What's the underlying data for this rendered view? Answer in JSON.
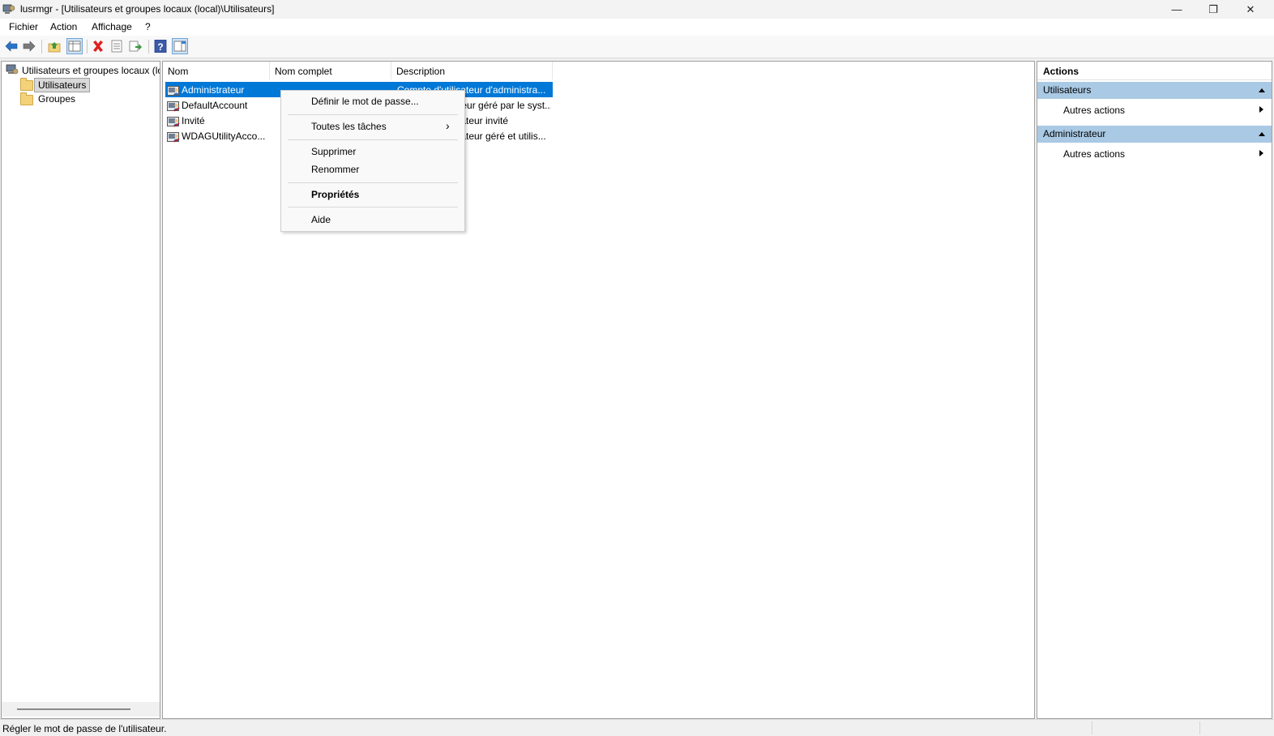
{
  "window": {
    "title": "lusrmgr - [Utilisateurs et groupes locaux (local)\\Utilisateurs]",
    "minimize_glyph": "—",
    "restore_glyph": "❐",
    "close_glyph": "✕"
  },
  "menu": {
    "items": [
      "Fichier",
      "Action",
      "Affichage",
      "?"
    ]
  },
  "toolbar": {
    "buttons": [
      "back-icon",
      "forward-icon",
      "up-folder-icon",
      "show-hide-tree-icon",
      "delete-icon",
      "properties-icon",
      "export-list-icon",
      "help-icon",
      "show-hide-action-pane-icon"
    ]
  },
  "tree": {
    "root": "Utilisateurs et groupes locaux (local)",
    "children": [
      "Utilisateurs",
      "Groupes"
    ],
    "selected": "Utilisateurs"
  },
  "list": {
    "columns": [
      "Nom",
      "Nom complet",
      "Description"
    ],
    "rows": [
      {
        "name": "Administrateur",
        "fullname": "",
        "description": "Compte d'utilisateur d'administra..."
      },
      {
        "name": "DefaultAccount",
        "fullname": "",
        "description": "Compte utilisateur géré par le syst..."
      },
      {
        "name": "Invité",
        "fullname": "",
        "description": "Compte d'utilisateur invité"
      },
      {
        "name": "WDAGUtilityAcco...",
        "fullname": "",
        "description": "Compte d'utilisateur géré et utilis..."
      }
    ],
    "selected_row": 0
  },
  "context_menu": {
    "set_password": "Définir le mot de passe...",
    "all_tasks": "Toutes les tâches",
    "all_tasks_arrow": "›",
    "delete": "Supprimer",
    "rename": "Renommer",
    "properties": "Propriétés",
    "help": "Aide"
  },
  "actions": {
    "header": "Actions",
    "sections": [
      {
        "title": "Utilisateurs",
        "item": "Autres actions"
      },
      {
        "title": "Administrateur",
        "item": "Autres actions"
      }
    ]
  },
  "status": {
    "text": "Régler le mot de passe de l'utilisateur."
  },
  "colors": {
    "selection": "#0078d7",
    "action_section": "#a9c9e4"
  }
}
